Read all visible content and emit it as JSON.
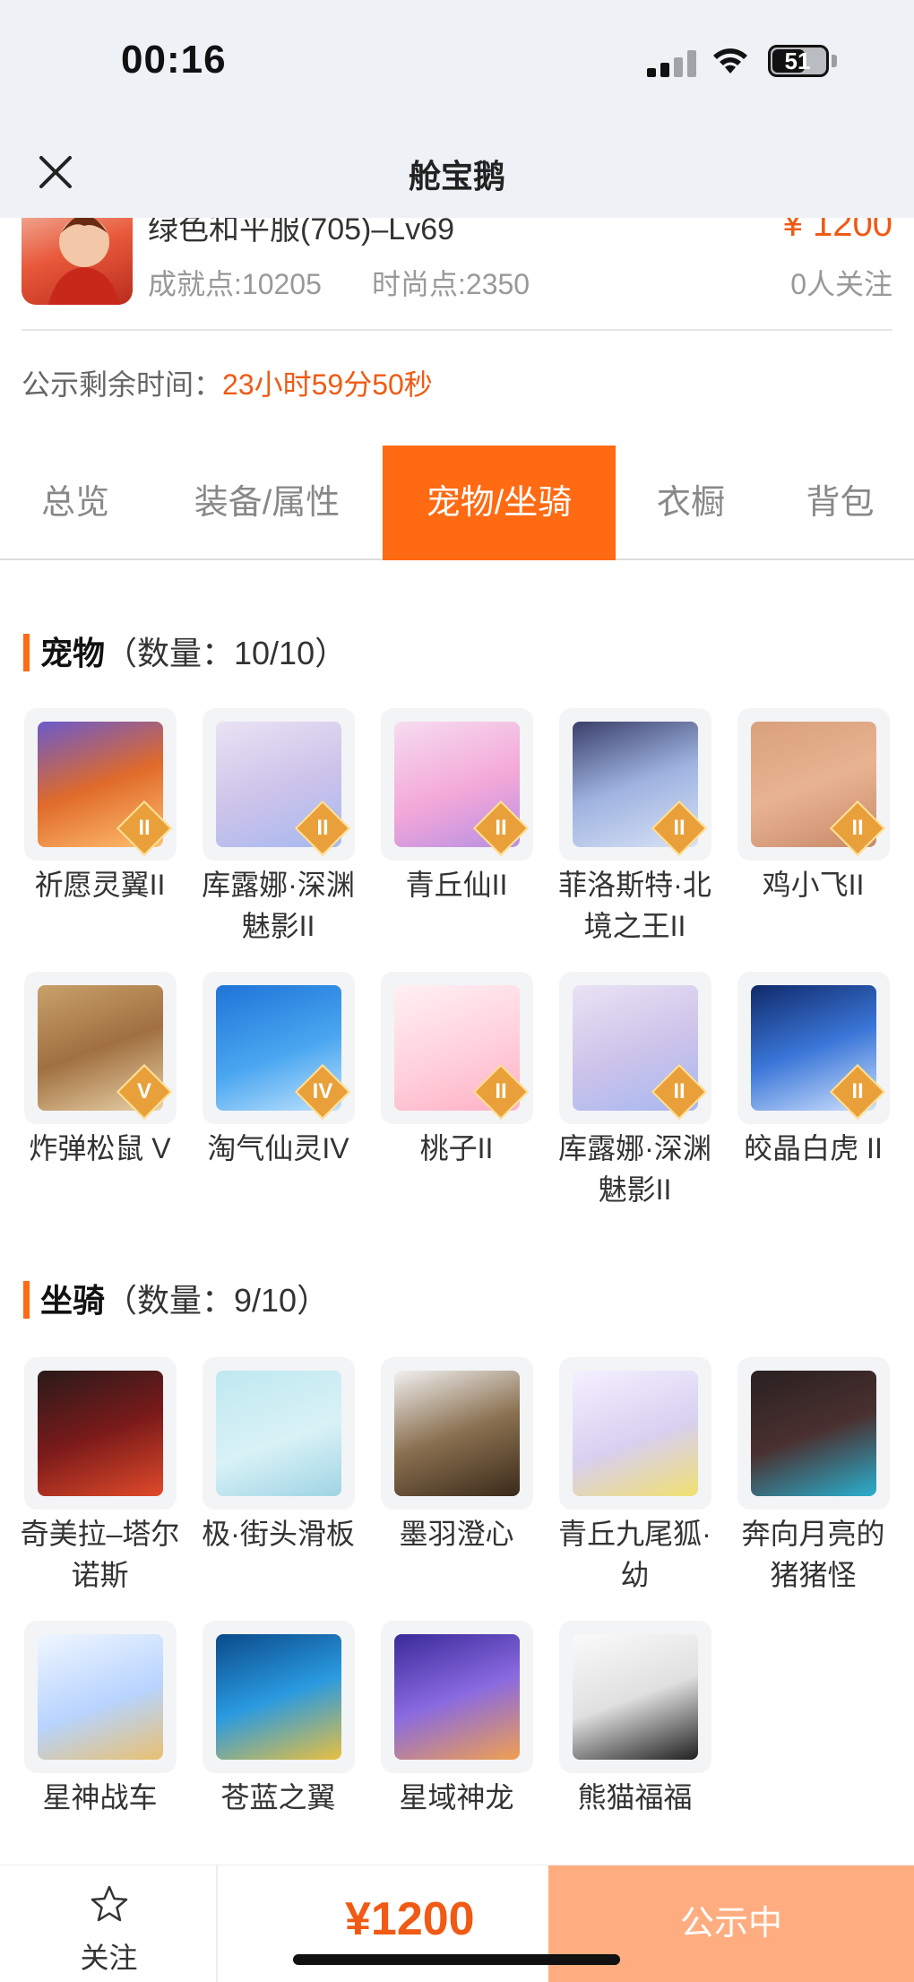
{
  "status": {
    "time": "00:16",
    "battery": "51"
  },
  "nav": {
    "title": "舱宝鹅"
  },
  "header": {
    "role_name": "绿色和平服(705)–Lv69",
    "price": "¥ 1200",
    "achievement": "成就点:10205",
    "fashion": "时尚点:2350",
    "followers": "0人关注",
    "notice_label": "公示剩余时间：",
    "notice_remaining": "23小时59分50秒"
  },
  "tabs": [
    "总览",
    "装备/属性",
    "宠物/坐骑",
    "衣橱",
    "背包"
  ],
  "pets": {
    "title": "宠物",
    "count": "（数量：10/10）",
    "items": [
      {
        "name": "祈愿灵翼II",
        "grade": "II"
      },
      {
        "name": "库露娜·深渊魅影II",
        "grade": "II"
      },
      {
        "name": "青丘仙II",
        "grade": "II"
      },
      {
        "name": "菲洛斯特·北境之王II",
        "grade": "II"
      },
      {
        "name": "鸡小飞II",
        "grade": "II"
      },
      {
        "name": "炸弹松鼠 V",
        "grade": "V"
      },
      {
        "name": "淘气仙灵IV",
        "grade": "IV"
      },
      {
        "name": "桃子II",
        "grade": "II"
      },
      {
        "name": "库露娜·深渊魅影II",
        "grade": "II"
      },
      {
        "name": "皎晶白虎 II",
        "grade": "II"
      }
    ]
  },
  "mounts": {
    "title": "坐骑",
    "count": "（数量：9/10）",
    "items": [
      {
        "name": "奇美拉–塔尔诺斯"
      },
      {
        "name": "极·街头滑板"
      },
      {
        "name": "墨羽澄心"
      },
      {
        "name": "青丘九尾狐·幼"
      },
      {
        "name": "奔向月亮的猪猪怪"
      },
      {
        "name": "星神战车"
      },
      {
        "name": "苍蓝之翼"
      },
      {
        "name": "星域神龙"
      },
      {
        "name": "熊猫福福"
      }
    ]
  },
  "bottom": {
    "follow_label": "关注",
    "price": "¥1200",
    "state_button": "公示中"
  },
  "colors": {
    "accent": "#ff6a13",
    "price": "#f05a14",
    "state_button": "#ffad80"
  }
}
